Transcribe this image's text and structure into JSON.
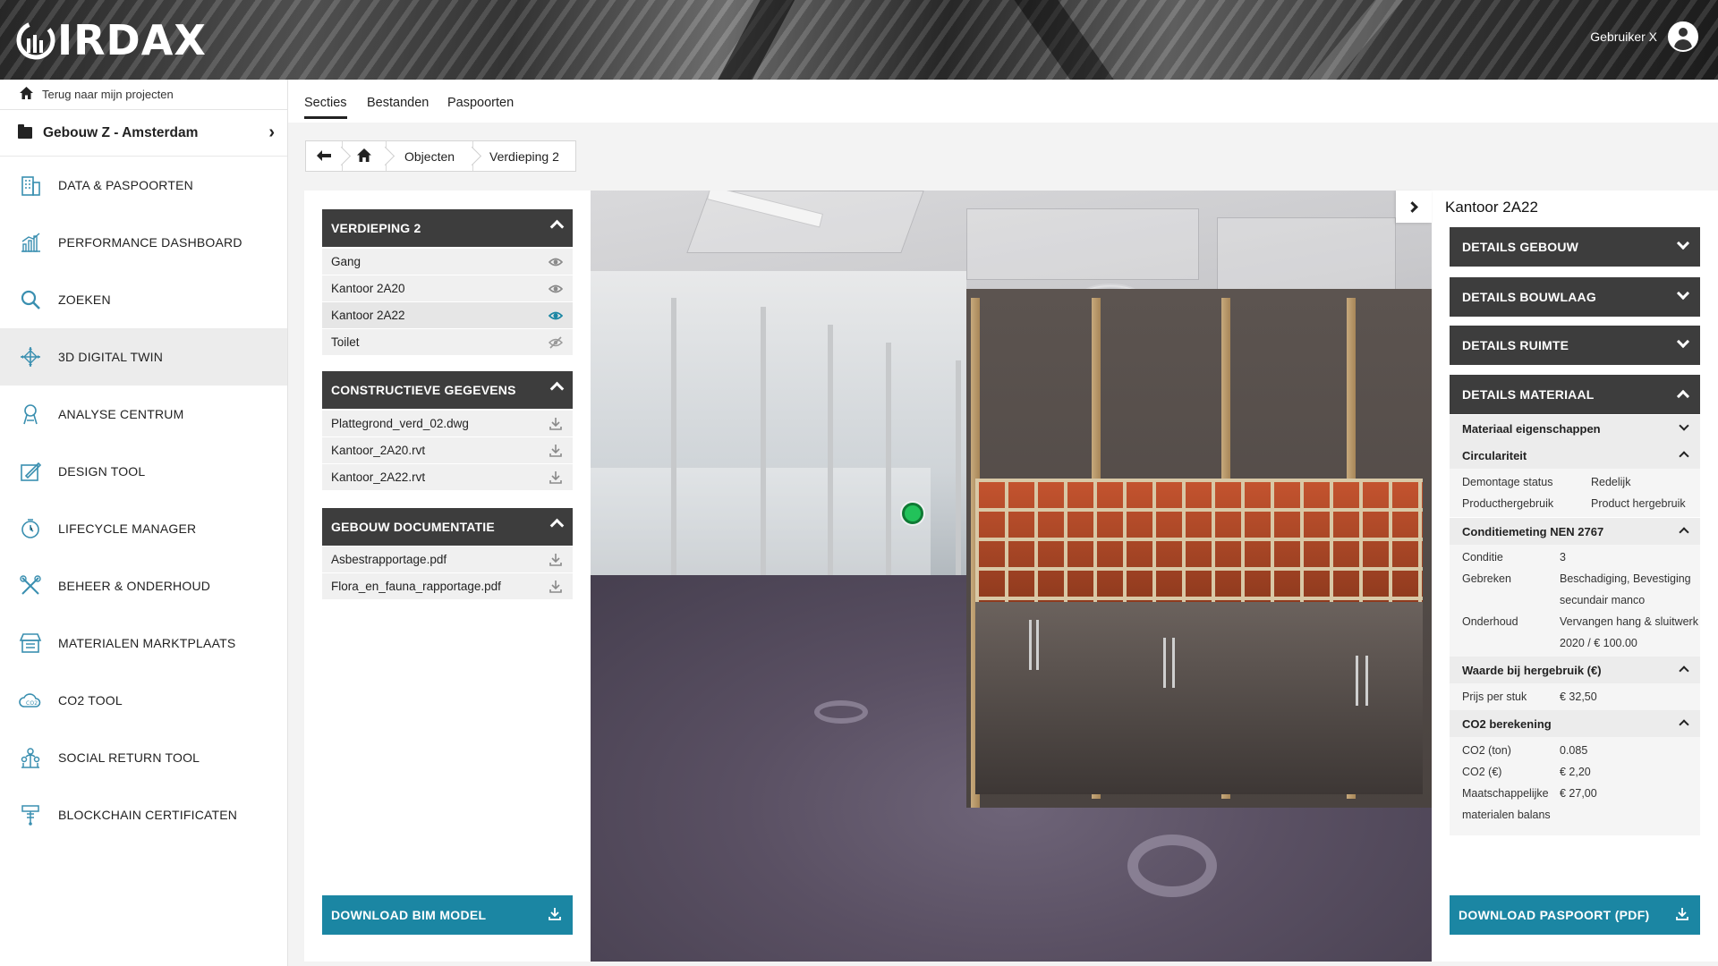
{
  "brand": {
    "name": "IRDAX"
  },
  "header": {
    "user_name": "Gebruiker X"
  },
  "sidebar": {
    "back_label": "Terug naar mijn projecten",
    "project_name": "Gebouw Z - Amsterdam",
    "items": [
      {
        "label": "DATA & PASPOORTEN",
        "icon": "building-icon"
      },
      {
        "label": "PERFORMANCE DASHBOARD",
        "icon": "bar-chart-icon"
      },
      {
        "label": "ZOEKEN",
        "icon": "search-icon"
      },
      {
        "label": "3D DIGITAL TWIN",
        "icon": "3d-axis-icon"
      },
      {
        "label": "ANALYSE CENTRUM",
        "icon": "analysis-icon"
      },
      {
        "label": "DESIGN TOOL",
        "icon": "design-icon"
      },
      {
        "label": "LIFECYCLE MANAGER",
        "icon": "lifecycle-icon"
      },
      {
        "label": "BEHEER & ONDERHOUD",
        "icon": "tools-icon"
      },
      {
        "label": "MATERIALEN MARKTPLAATS",
        "icon": "marketplace-icon"
      },
      {
        "label": "CO2 TOOL",
        "icon": "co2-cloud-icon"
      },
      {
        "label": "SOCIAL RETURN TOOL",
        "icon": "social-icon"
      },
      {
        "label": "BLOCKCHAIN CERTIFICATEN",
        "icon": "blockchain-icon"
      }
    ],
    "active_index": 3
  },
  "tabs": [
    {
      "label": "Secties",
      "active": true
    },
    {
      "label": "Bestanden",
      "active": false
    },
    {
      "label": "Paspoorten",
      "active": false
    }
  ],
  "breadcrumb": {
    "items": [
      "Objecten",
      "Verdieping 2"
    ]
  },
  "left_panel": {
    "floor": {
      "title": "VERDIEPING 2",
      "rows": [
        {
          "label": "Gang",
          "icon": "eye-icon",
          "state": "visible"
        },
        {
          "label": "Kantoor 2A20",
          "icon": "eye-icon",
          "state": "visible"
        },
        {
          "label": "Kantoor 2A22",
          "icon": "eye-icon",
          "state": "selected"
        },
        {
          "label": "Toilet",
          "icon": "eye-off-icon",
          "state": "hidden"
        }
      ]
    },
    "construction": {
      "title": "CONSTRUCTIEVE GEGEVENS",
      "rows": [
        "Plattegrond_verd_02.dwg",
        "Kantoor_2A20.rvt",
        "Kantoor_2A22.rvt"
      ]
    },
    "docs": {
      "title": "GEBOUW DOCUMENTATIE",
      "rows": [
        "Asbestrapportage.pdf",
        "Flora_en_fauna_rapportage.pdf"
      ]
    },
    "download_label": "DOWNLOAD BIM MODEL"
  },
  "right_panel": {
    "title": "Kantoor 2A22",
    "sections": {
      "gebouw": "DETAILS GEBOUW",
      "bouwlaag": "DETAILS BOUWLAAG",
      "ruimte": "DETAILS RUIMTE",
      "materiaal": "DETAILS MATERIAAL"
    },
    "material": {
      "eigenschappen": "Materiaal eigenschappen",
      "circulariteit": {
        "title": "Circulariteit",
        "rows": [
          {
            "k": "Demontage status",
            "v": "Redelijk"
          },
          {
            "k": "Producthergebruik",
            "v": "Product hergebruik"
          }
        ]
      },
      "conditie": {
        "title": "Conditiemeting NEN 2767",
        "rows": [
          {
            "k": "Conditie",
            "v": "3"
          },
          {
            "k": "Gebreken",
            "v": "Beschadiging, Bevestiging",
            "v2": "secundair manco"
          },
          {
            "k": "Onderhoud",
            "v": "Vervangen hang & sluitwerk",
            "v2": "2020  /  € 100.00"
          }
        ]
      },
      "waarde": {
        "title": "Waarde bij hergebruik (€)",
        "rows": [
          {
            "k": "Prijs per stuk",
            "v": "€ 32,50"
          }
        ]
      },
      "co2": {
        "title": "CO2 berekening",
        "rows": [
          {
            "k": "CO2 (ton)",
            "v": "0.085"
          },
          {
            "k": "CO2 (€)",
            "v": "€ 2,20"
          },
          {
            "k": "Maatschappelijke",
            "k2": "materialen balans",
            "v": "€ 27,00"
          }
        ]
      }
    },
    "download_label": "DOWNLOAD PASPOORT (PDF)"
  },
  "colors": {
    "accent": "#1b86a3",
    "header_dark": "#3d3d3d",
    "marker_green": "#22c25a"
  }
}
